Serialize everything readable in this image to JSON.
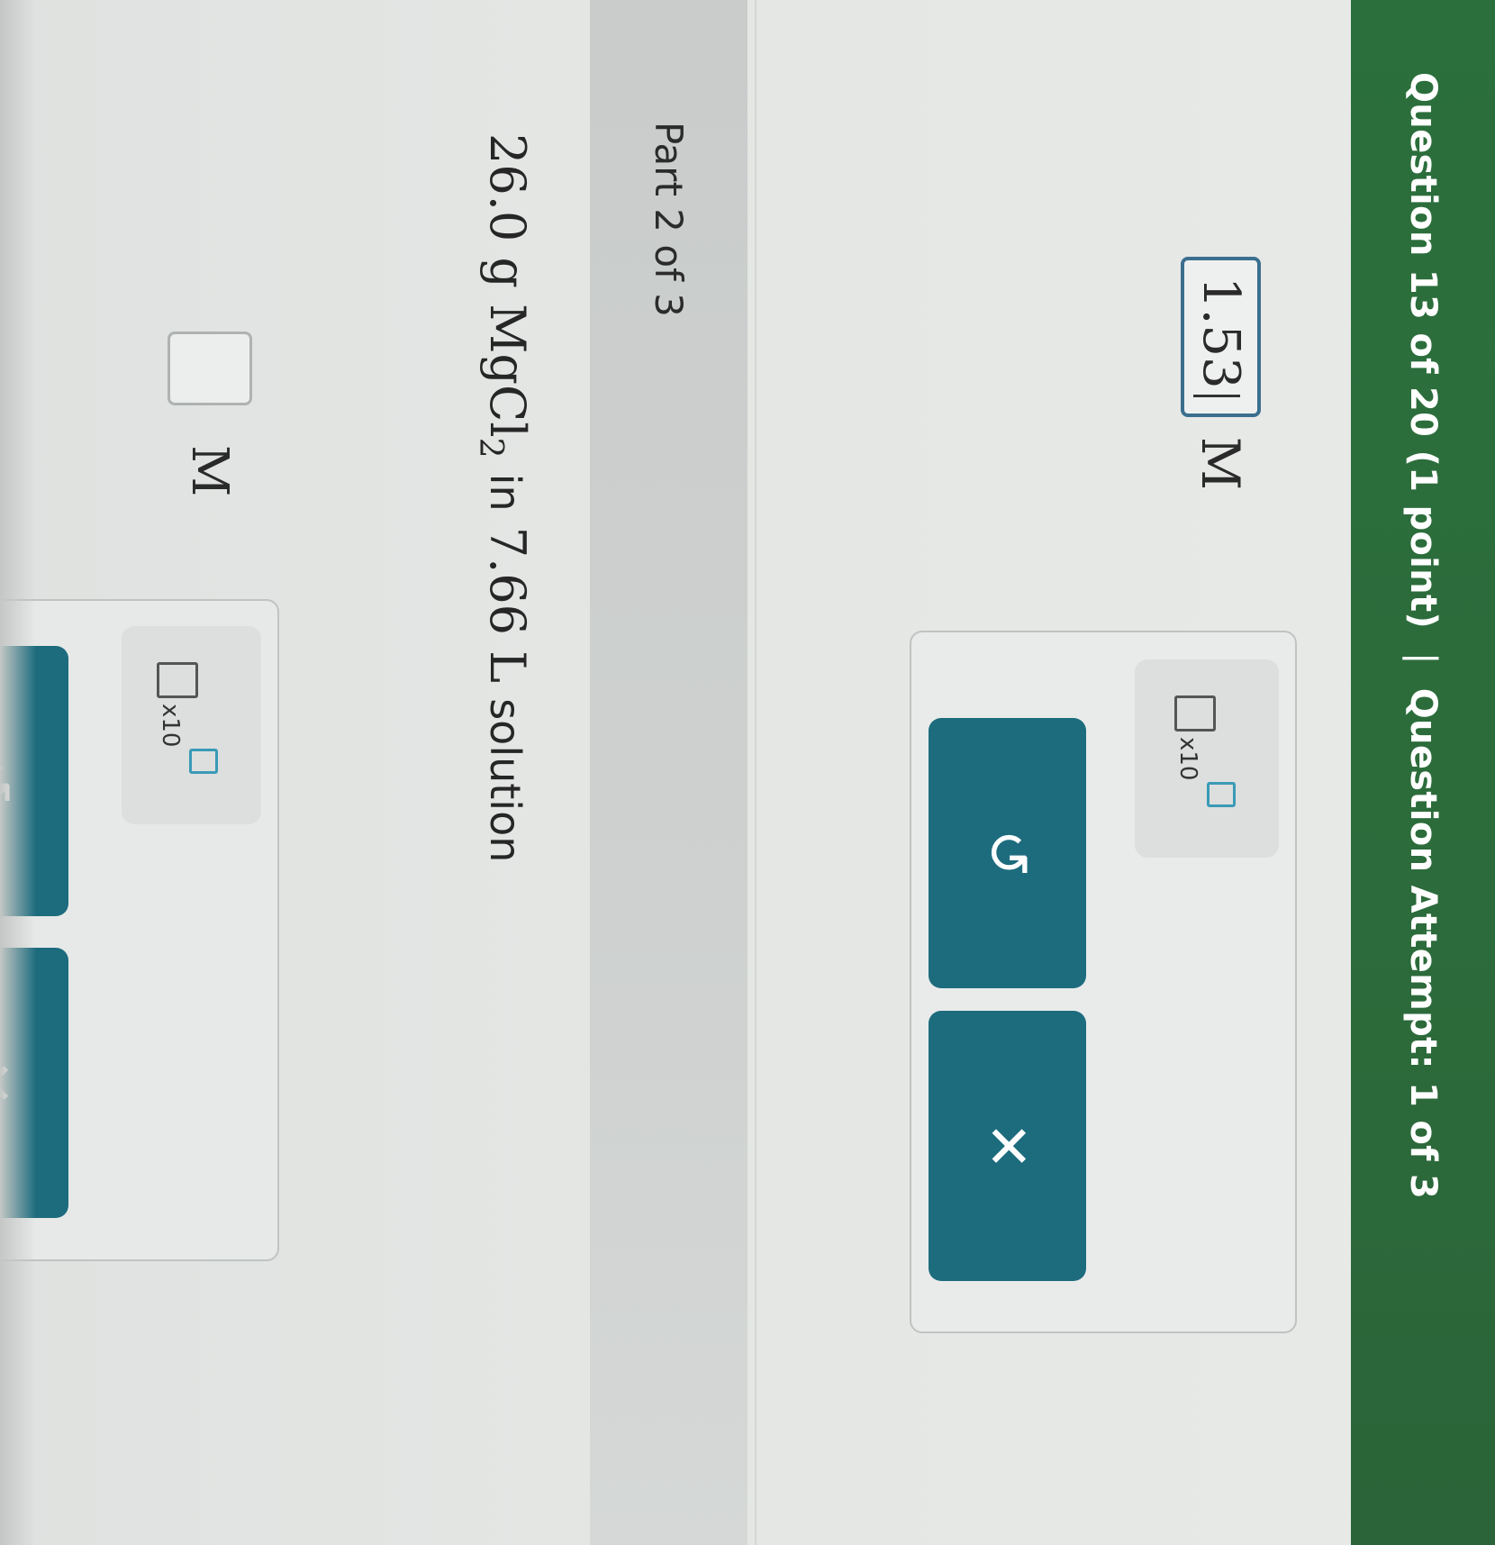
{
  "header": {
    "question": "Question 13 of 20 (1 point)",
    "separator": "|",
    "attempt": "Question Attempt: 1 of 3"
  },
  "part1": {
    "answer_value": "1.53",
    "unit": "M",
    "tools": {
      "x10_label": "x10",
      "undo_icon": "undo-icon",
      "clear_icon": "close-icon",
      "undo_glyph": "↺",
      "clear_glyph": "✕"
    }
  },
  "part2": {
    "label": "Part 2 of 3",
    "problem": {
      "amount": "26.0 g",
      "formula_main": "MgCl",
      "formula_sub": "2",
      "in_text": "in",
      "volume": "7.66 L",
      "tail": "solution"
    },
    "answer_value": "",
    "unit": "M",
    "tools": {
      "x10_label": "x10",
      "undo_glyph": "↺",
      "clear_glyph": "✕"
    }
  },
  "colors": {
    "header_bg": "#2b6f3c",
    "button_bg": "#1d6c7e",
    "input_border_active": "#3b6f8f",
    "exponent_box": "#3a9ab7"
  }
}
